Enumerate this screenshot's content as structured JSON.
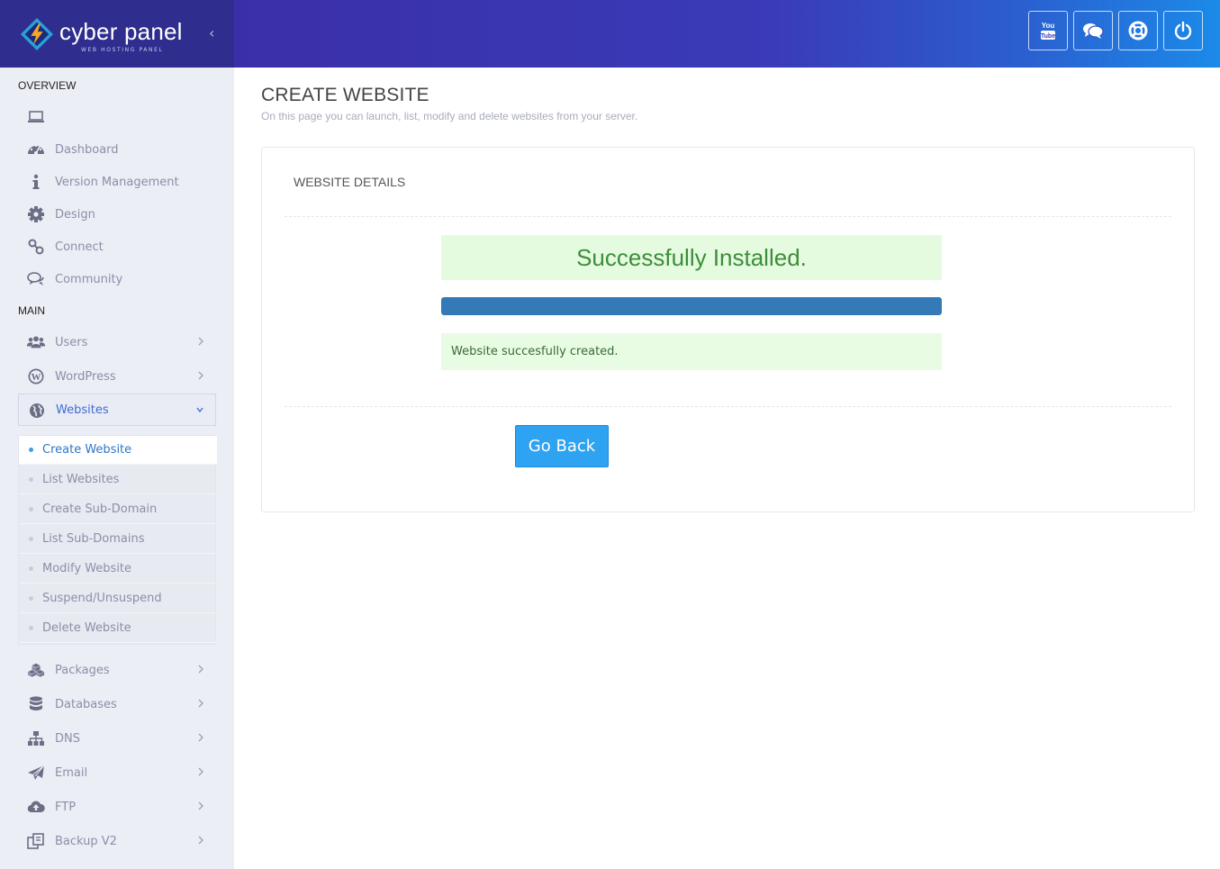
{
  "brand": {
    "name": "cyber panel",
    "tagline": "WEB HOSTING PANEL"
  },
  "header": {
    "collapse_glyph": "‹",
    "buttons": [
      {
        "icon": "youtube-icon"
      },
      {
        "icon": "chat-icon"
      },
      {
        "icon": "lifebuoy-icon"
      },
      {
        "icon": "power-icon"
      }
    ]
  },
  "sidebar": {
    "overview_title": "OVERVIEW",
    "main_title": "MAIN",
    "overview_items": [
      {
        "label": "",
        "icon": "laptop-icon"
      },
      {
        "label": "Dashboard",
        "icon": "dashboard-icon"
      },
      {
        "label": "Version Management",
        "icon": "info-icon"
      },
      {
        "label": "Design",
        "icon": "gear-icon"
      },
      {
        "label": "Connect",
        "icon": "link-icon"
      },
      {
        "label": "Community",
        "icon": "comments-icon"
      }
    ],
    "main_items": [
      {
        "label": "Users",
        "icon": "users-icon"
      },
      {
        "label": "WordPress",
        "icon": "wordpress-icon"
      },
      {
        "label": "Websites",
        "icon": "globe-icon"
      }
    ],
    "websites_submenu": [
      {
        "label": "Create Website"
      },
      {
        "label": "List Websites"
      },
      {
        "label": "Create Sub-Domain"
      },
      {
        "label": "List Sub-Domains"
      },
      {
        "label": "Modify Website"
      },
      {
        "label": "Suspend/Unsuspend"
      },
      {
        "label": "Delete Website"
      }
    ],
    "more_items": [
      {
        "label": "Packages",
        "icon": "cubes-icon"
      },
      {
        "label": "Databases",
        "icon": "database-icon"
      },
      {
        "label": "DNS",
        "icon": "sitemap-icon"
      },
      {
        "label": "Email",
        "icon": "paper-plane-icon"
      },
      {
        "label": "FTP",
        "icon": "cloud-upload-icon"
      },
      {
        "label": "Backup V2",
        "icon": "backup-icon"
      }
    ]
  },
  "main": {
    "title": "CREATE WEBSITE",
    "subtitle": "On this page you can launch, list, modify and delete websites from your server.",
    "panel": {
      "title": "WEBSITE DETAILS",
      "success_text": "Successfully Installed.",
      "progress_percent": 100,
      "message": "Website succesfully created.",
      "go_back_label": "Go Back"
    }
  },
  "colors": {
    "accent": "#2ea3f2",
    "progress": "#337ab7",
    "success_bg": "#e5fbe0",
    "success_text": "#3e8d3a",
    "sidebar_bg": "#eceef5",
    "icon": "#6a6f86"
  }
}
